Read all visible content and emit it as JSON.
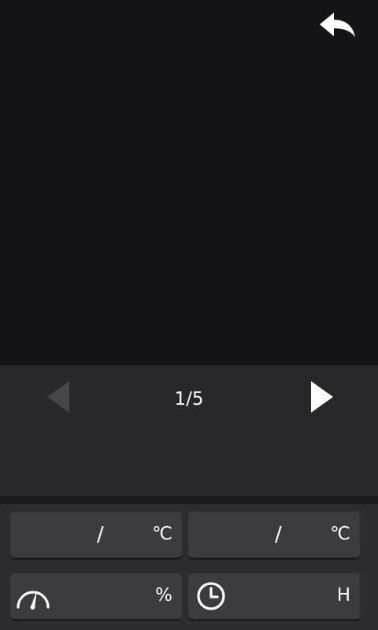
{
  "header": {
    "back_icon": "reply-arrow-icon"
  },
  "pager": {
    "prev_icon": "triangle-left-icon",
    "next_icon": "triangle-right-icon",
    "indicator": "1/5",
    "prev_enabled": false,
    "next_enabled": true
  },
  "cards": {
    "temp1": {
      "separator": "/",
      "unit": "℃"
    },
    "temp2": {
      "separator": "/",
      "unit": "℃"
    },
    "speed": {
      "icon": "gauge-icon",
      "unit": "%"
    },
    "timer": {
      "icon": "clock-icon",
      "unit": "H"
    }
  },
  "colors": {
    "background": "#141518",
    "panel": "#26282c",
    "card": "#3a3c40",
    "disabled_arrow": "#45474c",
    "text": "#ffffff"
  }
}
